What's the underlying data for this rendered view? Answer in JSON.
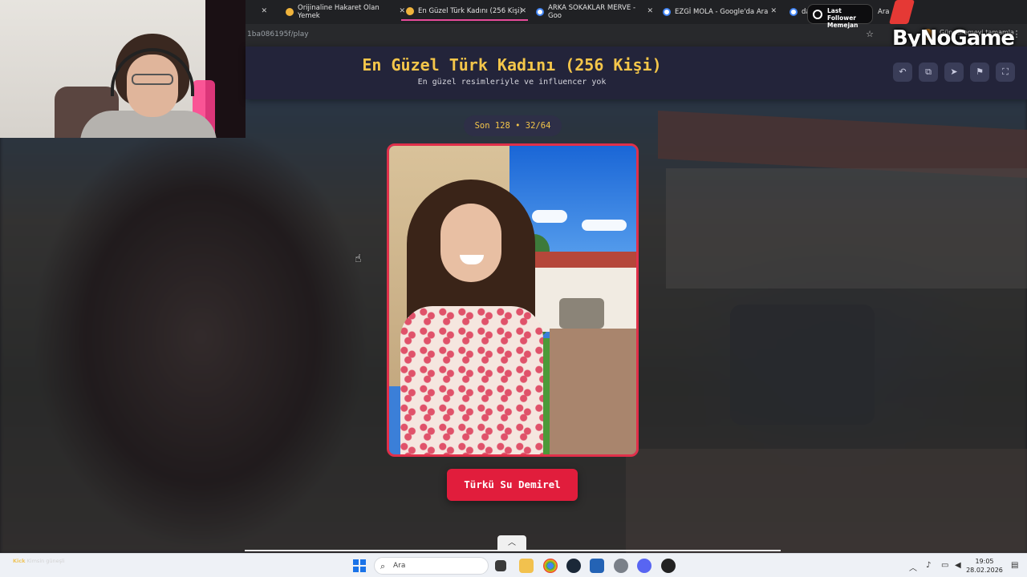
{
  "browser": {
    "tabs": [
      {
        "label": "Orijinaline Hakaret Olan Yemek"
      },
      {
        "label": "En Güzel Türk Kadını (256 Kişi)",
        "active": true
      },
      {
        "label": "ARKA SOKAKLAR MERVE - Goo"
      },
      {
        "label": "EZGİ MOLA - Google'da Ara"
      },
      {
        "label": "da"
      }
    ],
    "last_tab_suffix": "Ara",
    "url": "1ba086195f/play",
    "update_label": "Güncellemeyi tamamla"
  },
  "overlay": {
    "last_follower_title": "Last Follower",
    "last_follower_name": "Memejan",
    "brand": "ByNoGame"
  },
  "page": {
    "title": "En Güzel Türk Kadını (256 Kişi)",
    "subtitle": "En güzel resimleriyle ve influencer yok",
    "progress": "Son 128 • 32/64",
    "candidate_name": "Türkü Su Demirel",
    "tools": [
      "undo-icon",
      "link-icon",
      "share-icon",
      "flag-icon",
      "fullscreen-icon"
    ]
  },
  "chat": {
    "lines": [
      {
        "user": "Kick",
        "text": "Kimsin güneşli"
      }
    ]
  },
  "taskbar": {
    "search_placeholder": "Ara",
    "time": "19:05",
    "date": "28.02.2026"
  },
  "colors": {
    "accent_title": "#f4c64a",
    "name_button": "#e11d3c",
    "card_border": "#e0304a",
    "header_bg": "#23243a"
  }
}
